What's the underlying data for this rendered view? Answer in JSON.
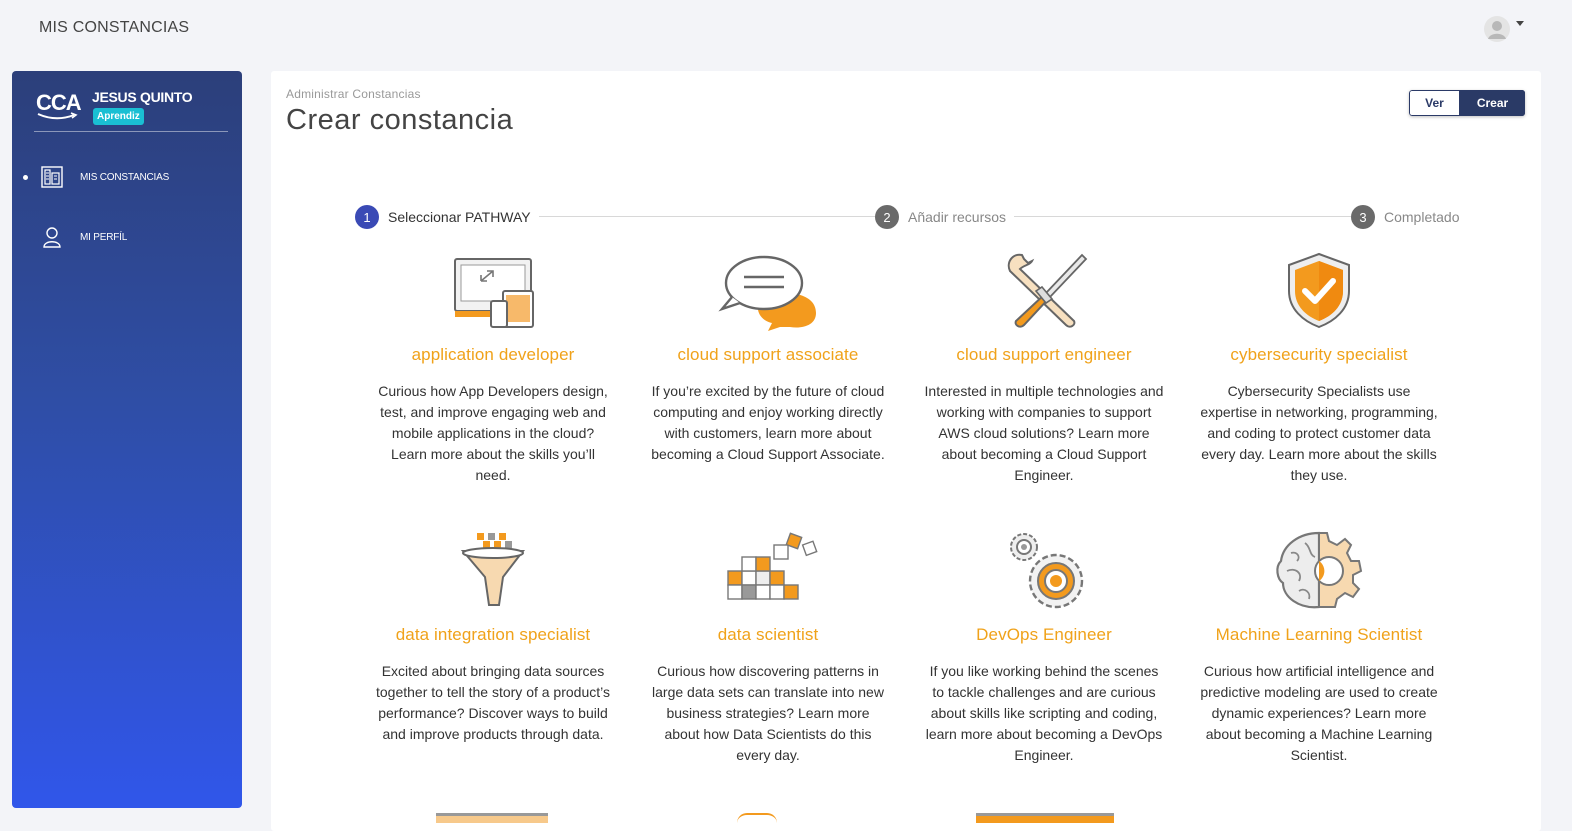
{
  "topbar": {
    "app_title": "MIS CONSTANCIAS",
    "avatar_icon": "user-avatar-icon"
  },
  "sidebar": {
    "logo_text": "CCA",
    "user_name": "JESUS QUINTO",
    "role_badge": "Aprendiz",
    "items": [
      {
        "label": "MIS CONSTANCIAS",
        "icon": "building-icon",
        "active": true
      },
      {
        "label": "MI PERFÍL",
        "icon": "user-icon",
        "active": false
      }
    ]
  },
  "main": {
    "breadcrumb": "Administrar Constancias",
    "title": "Crear constancia",
    "buttons": {
      "ver": "Ver",
      "crear": "Crear"
    },
    "steps": [
      {
        "number": "1",
        "label": "Seleccionar PATHWAY",
        "active": true
      },
      {
        "number": "2",
        "label": "Añadir recursos",
        "active": false
      },
      {
        "number": "3",
        "label": "Completado",
        "active": false
      }
    ],
    "colors": {
      "accent": "#f0a21a",
      "step_active": "#3a4ab5",
      "step_inactive": "#666666",
      "sidebar_top": "#2c3f7a",
      "sidebar_bottom": "#3056ea"
    },
    "pathways": [
      {
        "title": "application developer",
        "icon": "responsive-devices-icon",
        "description": "Curious how App Developers design, test, and improve engaging web and mobile applications in the cloud? Learn more about the skills you’ll need."
      },
      {
        "title": "cloud support associate",
        "icon": "chat-bubbles-icon",
        "description": "If you’re excited by the future of cloud computing and enjoy working directly with customers, learn more about becoming a Cloud Support Associate."
      },
      {
        "title": "cloud support engineer",
        "icon": "wrench-screwdriver-icon",
        "description": "Interested in multiple technologies and working with companies to support AWS cloud solutions? Learn more about becoming a Cloud Support Engineer."
      },
      {
        "title": "cybersecurity specialist",
        "icon": "shield-check-icon",
        "description": "Cybersecurity Specialists use expertise in networking, programming, and coding to protect customer data every day. Learn more about the skills they use."
      },
      {
        "title": "data integration specialist",
        "icon": "funnel-icon",
        "description": "Excited about bringing data sources together to tell the story of a product’s performance? Discover ways to build and improve products through data."
      },
      {
        "title": "data scientist",
        "icon": "data-cubes-icon",
        "description": "Curious how discovering patterns in large data sets can translate into new business strategies? Learn more about how Data Scientists do this every day."
      },
      {
        "title": "DevOps Engineer",
        "icon": "gears-icon",
        "description": "If you like working behind the scenes to tackle challenges and are curious about skills like scripting and coding, learn more about becoming a DevOps Engineer."
      },
      {
        "title": "Machine Learning Scientist",
        "icon": "brain-gear-icon",
        "description": "Curious how artificial intelligence and predictive modeling are used to create dynamic experiences? Learn more about becoming a Machine Learning Scientist."
      }
    ]
  }
}
